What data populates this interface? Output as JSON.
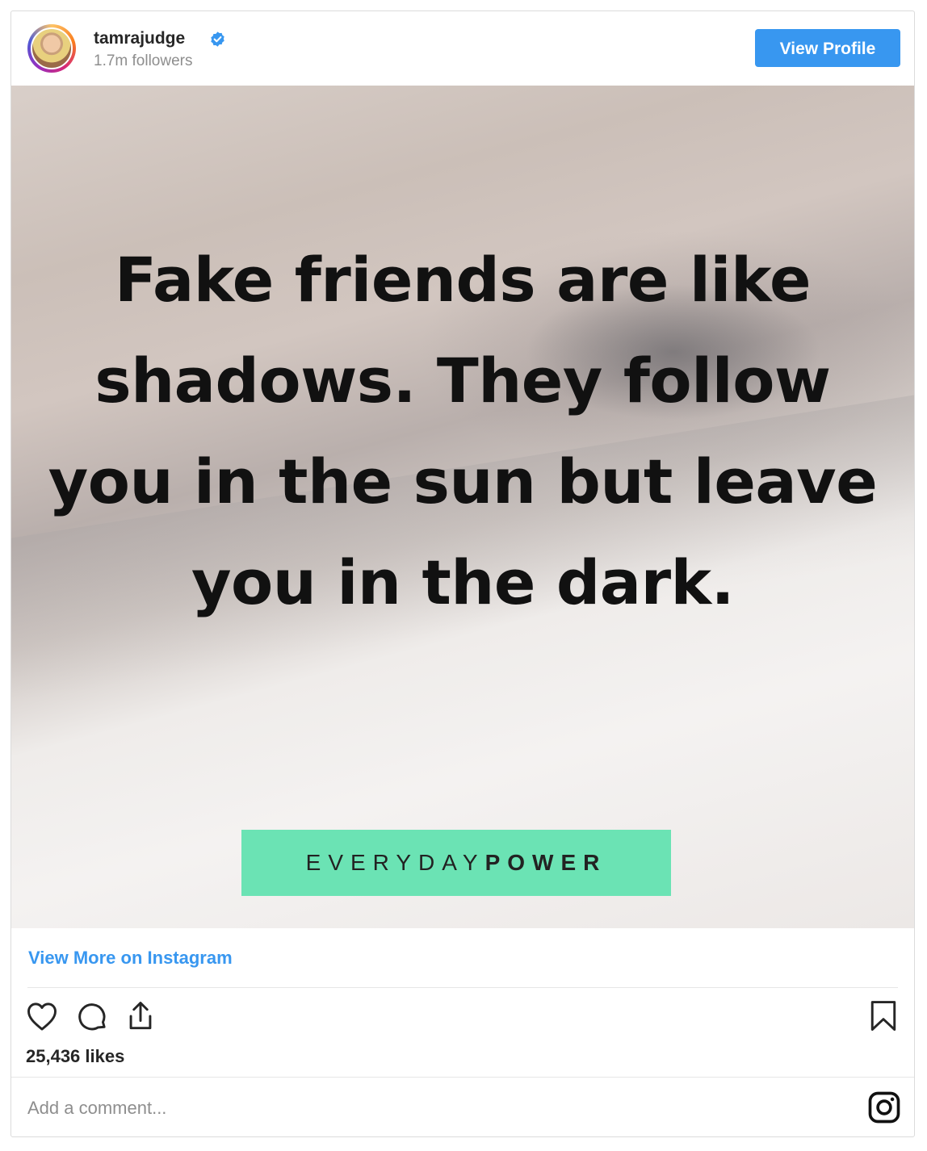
{
  "header": {
    "username": "tamrajudge",
    "followers": "1.7m followers",
    "view_profile_label": "View Profile",
    "verified_icon": "verified-badge-icon"
  },
  "post": {
    "quote": "Fake friends are like shadows. They follow you in the sun but leave you in the dark.",
    "brand_light": "EVERYDAY",
    "brand_bold": "POWER",
    "brand_color": "#6be3b4"
  },
  "footer": {
    "view_more_label": "View More on Instagram",
    "likes": "25,436 likes",
    "comment_placeholder": "Add a comment...",
    "icons": [
      "heart-icon",
      "comment-icon",
      "share-icon",
      "bookmark-icon",
      "instagram-logo-icon"
    ]
  },
  "colors": {
    "accent": "#3897f0",
    "muted_text": "#8e8e8e"
  }
}
